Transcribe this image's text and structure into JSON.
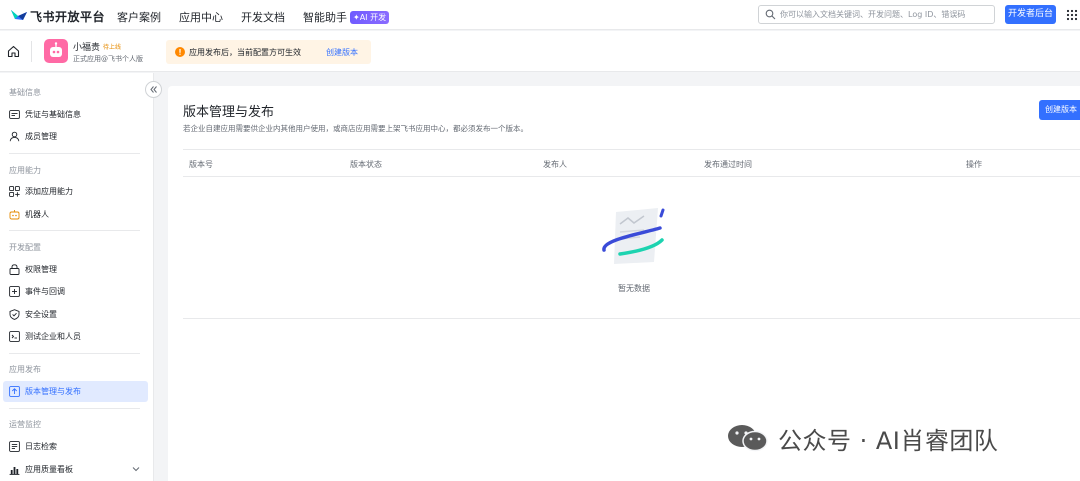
{
  "topnav": {
    "brand": "飞书开放平台",
    "links": [
      "客户案例",
      "应用中心",
      "开发文档",
      "智能助手"
    ],
    "ai_badge": "✦AI 开发",
    "search_placeholder": "你可以输入文档关键词、开发问题、Log ID、错误码",
    "dev_console_label": "开发者后台"
  },
  "appbar": {
    "app_name": "小福贵",
    "app_status": "待上线",
    "app_sub": "正式应用@飞书个人版",
    "notice_text": "应用发布后，当前配置方可生效",
    "notice_link": "创建版本"
  },
  "sidebar": {
    "sections": [
      {
        "title": "基础信息",
        "items": [
          "凭证与基础信息",
          "成员管理"
        ]
      },
      {
        "title": "应用能力",
        "items": [
          "添加应用能力",
          "机器人"
        ]
      },
      {
        "title": "开发配置",
        "items": [
          "权限管理",
          "事件与回调",
          "安全设置",
          "测试企业和人员"
        ]
      },
      {
        "title": "应用发布",
        "items": [
          "版本管理与发布"
        ]
      },
      {
        "title": "运营监控",
        "items": [
          "日志检索",
          "应用质量看板"
        ]
      }
    ],
    "active_item": "版本管理与发布"
  },
  "main": {
    "title": "版本管理与发布",
    "description": "若企业自建应用需要供企业内其他用户使用，或商店应用需要上架飞书应用中心，都必须发布一个版本。",
    "create_button": "创建版本",
    "columns": [
      "版本号",
      "版本状态",
      "发布人",
      "发布通过时间",
      "操作"
    ],
    "empty_text": "暂无数据"
  },
  "watermark": "公众号 · AI肖睿团队",
  "colors": {
    "accent": "#3370ff",
    "notice_bg": "#fff4e5",
    "active_bg": "#e1eaff"
  }
}
